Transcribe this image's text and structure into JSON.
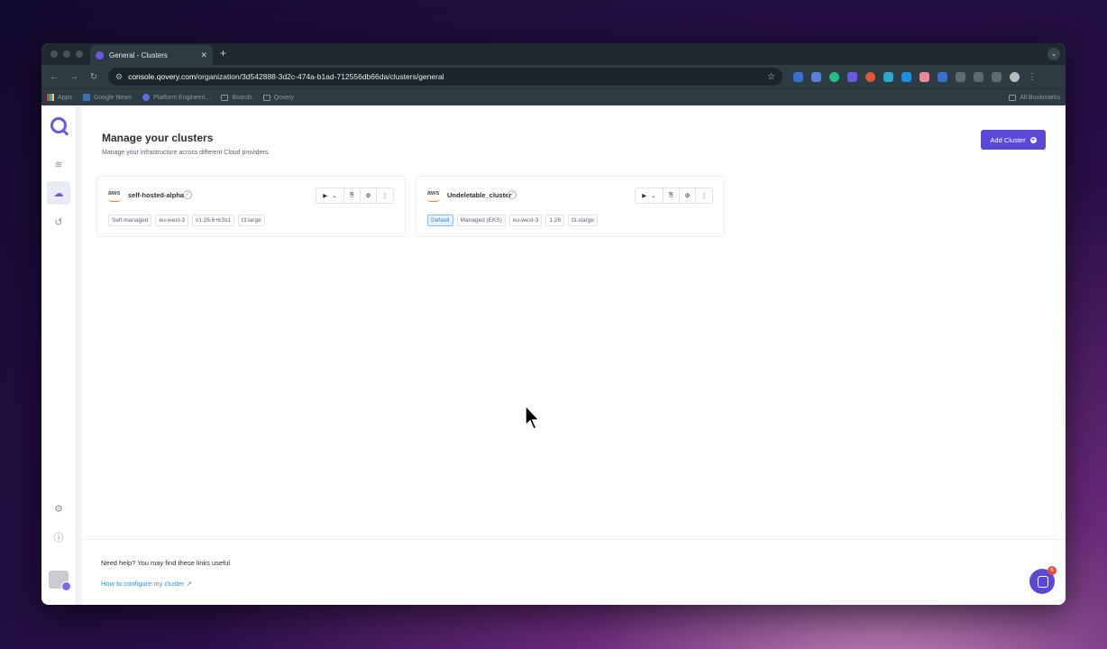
{
  "browser": {
    "tab_title": "General - Clusters",
    "url_domain": "console.qovery.com",
    "url_path": "/organization/3d542888-3d2c-474a-b1ad-712556db66da/clusters/general",
    "bookmarks": [
      "Apps",
      "Google News",
      "Platform Engineeri...",
      "Boards",
      "Qovery"
    ],
    "all_bookmarks": "All Bookmarks"
  },
  "page": {
    "title": "Manage your clusters",
    "subtitle": "Manage your infrastructure across different Cloud providers.",
    "add_button": "Add Cluster"
  },
  "clusters": [
    {
      "provider": "aws",
      "name": "self-hosted-alpha",
      "tags": [
        "Self-managed",
        "eu-west-3",
        "v1.26.6+k3s1",
        "t3.large"
      ]
    },
    {
      "provider": "aws",
      "name": "Undeletable_cluster",
      "tags": [
        "Default",
        "Managed (EKS)",
        "eu-west-3",
        "1.26",
        "t3.xlarge"
      ]
    }
  ],
  "help": {
    "title": "Need help? You may find these links useful",
    "link": "How to configure my cluster"
  },
  "chat_badge": "6",
  "colors": {
    "accent": "#5a49d6",
    "link": "#3b8fd4",
    "default_tag": "#3b82c4"
  }
}
